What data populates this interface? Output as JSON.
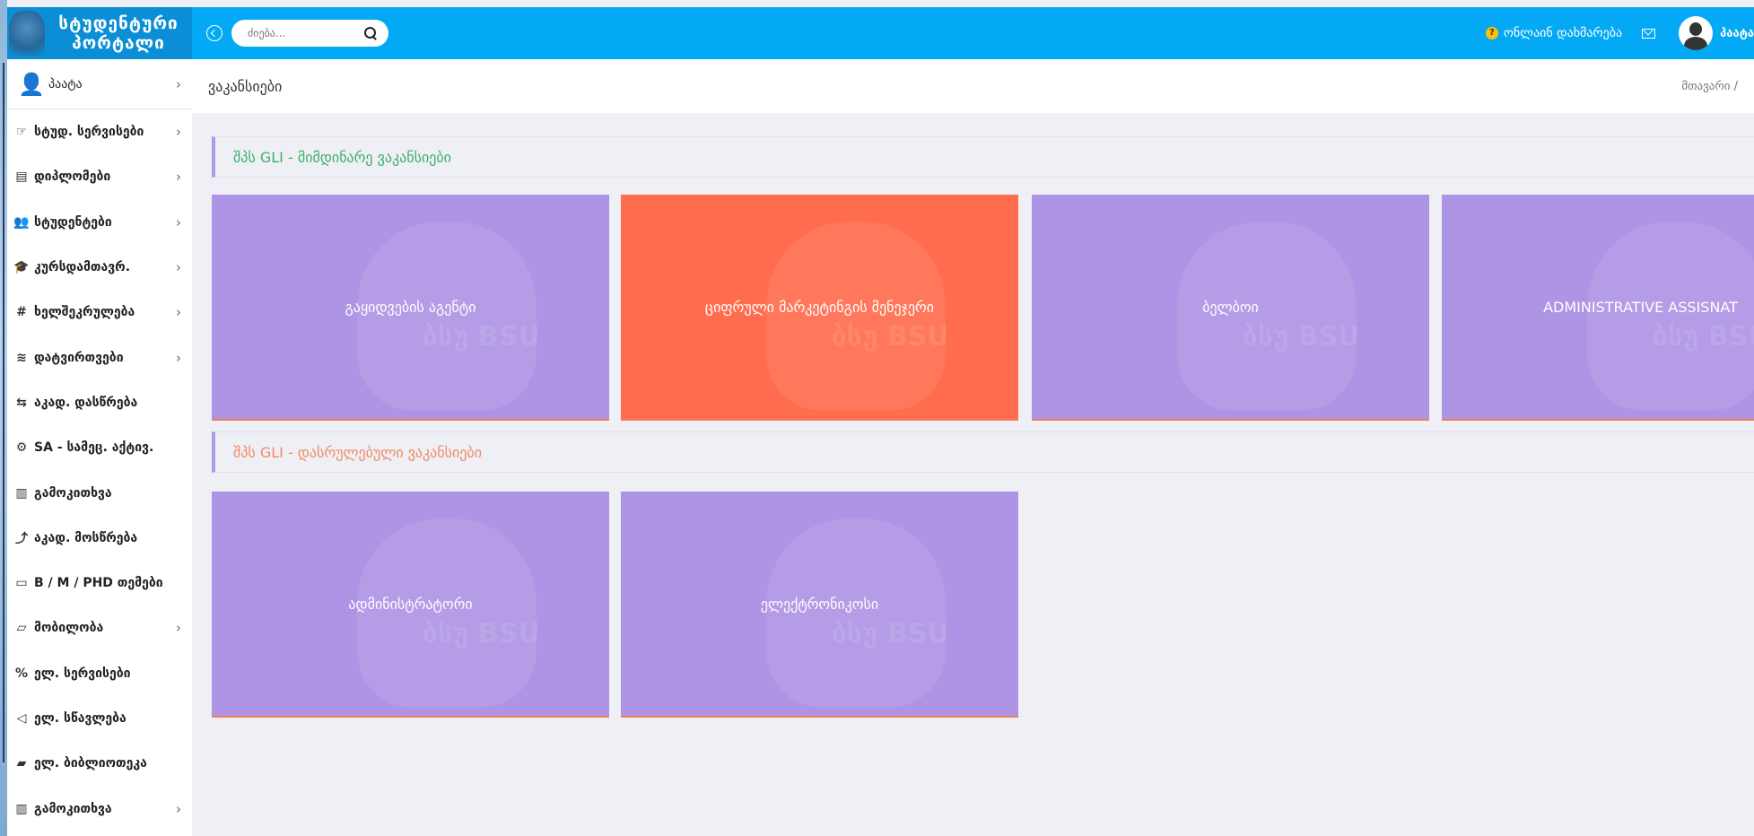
{
  "header": {
    "logo_line1": "სტუდენტური",
    "logo_line2": "პორტალი",
    "search_placeholder": "ძიება...",
    "help_label": "ონლაინ დახმარება",
    "user_name": "პაატა"
  },
  "sidebar": {
    "user": "პაატა",
    "items": [
      {
        "icon": "☞",
        "label": "სტუდ. სერვისები",
        "chevron": true
      },
      {
        "icon": "▤",
        "label": "დიპლომები",
        "chevron": true
      },
      {
        "icon": "👥",
        "label": "სტუდენტები",
        "chevron": true
      },
      {
        "icon": "🎓",
        "label": "კურსდამთავრ.",
        "chevron": true
      },
      {
        "icon": "#",
        "label": "ხელშეკრულება",
        "chevron": true
      },
      {
        "icon": "≋",
        "label": "დატვირთვები",
        "chevron": true
      },
      {
        "icon": "⇆",
        "label": "აკად. დასწრება",
        "chevron": false
      },
      {
        "icon": "⚙",
        "label": "SA - სამეც. აქტივ.",
        "chevron": false
      },
      {
        "icon": "▥",
        "label": "გამოკითხვა",
        "chevron": false
      },
      {
        "icon": "⤴",
        "label": "აკად. მოსწრება",
        "chevron": false
      },
      {
        "icon": "▭",
        "label": "B / M / PHD თემები",
        "chevron": false
      },
      {
        "icon": "▱",
        "label": "მობილობა",
        "chevron": true
      },
      {
        "icon": "%",
        "label": "ელ. სერვისები",
        "chevron": false
      },
      {
        "icon": "◁",
        "label": "ელ. სწავლება",
        "chevron": false
      },
      {
        "icon": "▰",
        "label": "ელ. ბიბლიოთეკა",
        "chevron": false
      },
      {
        "icon": "▥",
        "label": "გამოკითხვა",
        "chevron": true
      }
    ]
  },
  "page": {
    "title": "ვაკანსიები",
    "breadcrumb": "მთავარი /"
  },
  "sections": {
    "current_title": "შპს GLI - მიმდინარე ვაკანსიები",
    "closed_title": "შპს GLI - დასრულებული ვაკანსიები"
  },
  "current_vacancies": [
    {
      "label": "გაყიდვების აგენტი",
      "active": false
    },
    {
      "label": "ციფრული მარკეტინგის მენეჯერი",
      "active": true
    },
    {
      "label": "ბელბოი",
      "active": false
    },
    {
      "label": "ADMINISTRATIVE ASSISNAT",
      "active": false
    }
  ],
  "closed_vacancies": [
    {
      "label": "ადმინისტრატორი",
      "active": false
    },
    {
      "label": "ელექტრონიკოსი",
      "active": false
    }
  ],
  "watermark": "ბსუ BSU",
  "colors": {
    "topbar": "#03a9f4",
    "card": "#ae94e4",
    "card_active": "#ff6d4e",
    "current_title": "#3fae6a",
    "closed_title": "#f28a62"
  }
}
